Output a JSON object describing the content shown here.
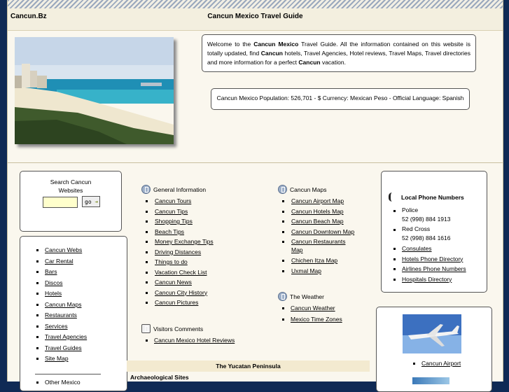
{
  "header": {
    "site_name": "Cancun.Bz",
    "title": "Cancun Mexico Travel Guide"
  },
  "photo": {
    "alt": "Cancun beach and hotel zone"
  },
  "welcome": {
    "t1": "Welcome to the ",
    "b1": "Cancun Mexico",
    "t2": " Travel Guide. All the information contained on this website is totally updated, find ",
    "b2": "Cancun",
    "t3": " hotels, Travel Agencies, Hotel reviews, Travel Maps, Travel directories and more information for a perfect ",
    "b3": "Cancun",
    "t4": " vacation."
  },
  "population": "Cancun Mexico Population: 526,701 - $ Currency: Mexican Peso - Official Language: Spanish",
  "search": {
    "label": "Search Cancun Websites",
    "value": "",
    "go": "go"
  },
  "nav": {
    "items": [
      "Cancun Webs",
      "Car Rental",
      "Bars",
      "Discos",
      "Hotels",
      "Cancun Maps",
      "Restaurants",
      "Services",
      "Travel Agencies",
      "Travel Guides",
      "Site Map"
    ],
    "other": "Other Mexico"
  },
  "general": {
    "heading": "General Information",
    "items": [
      "Cancun Tours",
      "Cancun Tips",
      "Shopping Tips",
      "Beach Tips",
      "Money Exchange Tips",
      "Driving Distances",
      "Things to do",
      "Vacation Check List",
      "Cancun News",
      "Cancun City History",
      "Cancun Pictures"
    ]
  },
  "maps": {
    "heading": "Cancun Maps",
    "items": [
      "Cancun Airport Map",
      "Cancun Hotels Map",
      "Cancun Beach Map",
      "Cancun Downtown Map",
      "Cancun Restaurants Map",
      "Chichen Itza Map",
      "Uxmal Map"
    ]
  },
  "weather": {
    "heading": "The Weather",
    "items": [
      "Cancun Weather",
      "Mexico Time Zones"
    ]
  },
  "visitors": {
    "heading": "Visitors Comments",
    "items": [
      "Cancun Mexico Hotel Reviews"
    ]
  },
  "peninsula": "The Yucatan Peninsula",
  "archaeological": "Archaeological Sites",
  "phones": {
    "heading": "Local Phone Numbers",
    "entries": [
      {
        "name": "Police",
        "number": "52 (998) 884 1913"
      },
      {
        "name": "Red Cross",
        "number": "52 (998) 884 1616"
      }
    ],
    "links": [
      "Consulates",
      "Hotels Phone Directory",
      "Airlines Phone Numbers",
      "Hospitals Directory"
    ]
  },
  "airport": {
    "caption": "Cancun Airport"
  }
}
